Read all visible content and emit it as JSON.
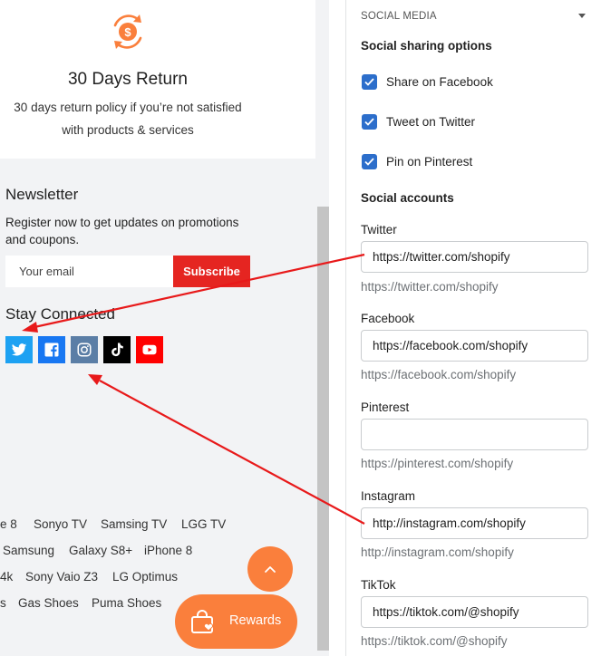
{
  "store": {
    "return_card": {
      "title": "30 Days Return",
      "desc_line1": "30 days return policy if you’re not satisfied",
      "desc_line2": "with products & services"
    },
    "newsletter": {
      "title": "Newsletter",
      "desc_line1": "Register now to get updates on promotions",
      "desc_line2": "and coupons.",
      "email_placeholder": "Your email",
      "subscribe_label": "Subscribe"
    },
    "stay_connected": "Stay Connected",
    "social_icons": [
      "twitter-icon",
      "facebook-icon",
      "instagram-icon",
      "tiktok-icon",
      "youtube-icon"
    ],
    "tags": {
      "row1": [
        "e 8",
        "Sonyo TV",
        "Samsing TV",
        "LGG TV"
      ],
      "row2": [
        "Samsung",
        "Galaxy S8+",
        "iPhone 8"
      ],
      "row3": [
        "4k",
        "Sony Vaio Z3",
        "LG Optimus"
      ],
      "row4": [
        "s",
        "Gas Shoes",
        "Puma Shoes"
      ]
    },
    "rewards_label": "Rewards"
  },
  "settings": {
    "section_title": "SOCIAL MEDIA",
    "sharing_title": "Social sharing options",
    "sharing_options": [
      {
        "label": "Share on Facebook",
        "checked": true
      },
      {
        "label": "Tweet on Twitter",
        "checked": true
      },
      {
        "label": "Pin on Pinterest",
        "checked": true
      }
    ],
    "accounts_title": "Social accounts",
    "accounts": [
      {
        "label": "Twitter",
        "value": "https://twitter.com/shopify",
        "help": "https://twitter.com/shopify"
      },
      {
        "label": "Facebook",
        "value": "https://facebook.com/shopify",
        "help": "https://facebook.com/shopify"
      },
      {
        "label": "Pinterest",
        "value": "",
        "help": "https://pinterest.com/shopify"
      },
      {
        "label": "Instagram",
        "value": "http://instagram.com/shopify",
        "help": "http://instagram.com/shopify"
      },
      {
        "label": "TikTok",
        "value": "https://tiktok.com/@shopify",
        "help": "https://tiktok.com/@shopify"
      }
    ]
  },
  "colors": {
    "accent_orange": "#fa7f3c",
    "subscribe_red": "#e52521",
    "checkbox_blue": "#2c6ecb",
    "arrow_red": "#e8191a"
  }
}
